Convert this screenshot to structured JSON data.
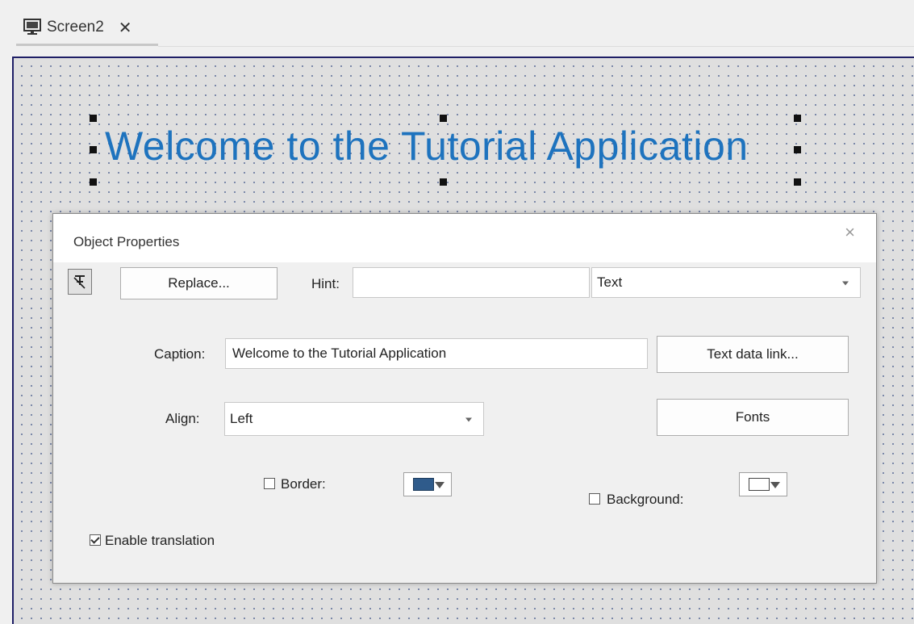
{
  "tab": {
    "label": "Screen2",
    "close_glyph": "✕",
    "icon": "monitor-icon"
  },
  "canvas": {
    "welcome_text": "Welcome to the Tutorial Application",
    "text_color": "#1e73be"
  },
  "dialog": {
    "title": "Object Properties",
    "close_glyph": "×",
    "pin_icon": "pin-icon",
    "replace_label": "Replace...",
    "hint_label": "Hint:",
    "hint_value": "",
    "type_value": "Text",
    "caption_label": "Caption:",
    "caption_value": "Welcome to the Tutorial Application",
    "text_data_link_label": "Text data link...",
    "align_label": "Align:",
    "align_value": "Left",
    "fonts_label": "Fonts",
    "border_label": "Border:",
    "border_checked": false,
    "border_color": "#2f5b8b",
    "background_label": "Background:",
    "background_checked": false,
    "background_color": "#ffffff",
    "enable_translation_label": "Enable translation",
    "enable_translation_checked": true
  }
}
